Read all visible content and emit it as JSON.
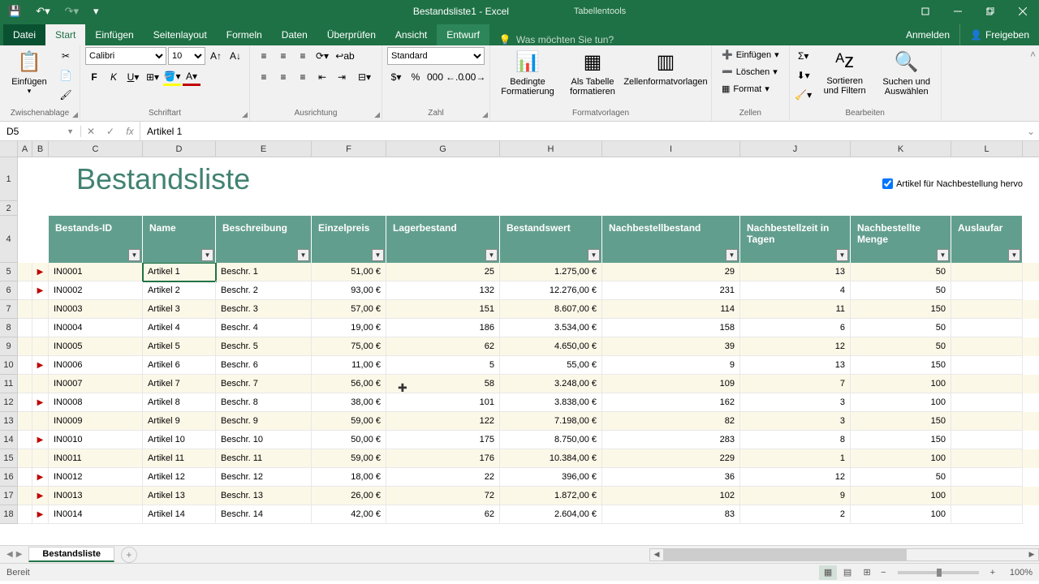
{
  "titlebar": {
    "app_title": "Bestandsliste1 - Excel",
    "table_tools": "Tabellentools"
  },
  "ribbon_tabs": {
    "datei": "Datei",
    "start": "Start",
    "einfuegen": "Einfügen",
    "seitenlayout": "Seitenlayout",
    "formeln": "Formeln",
    "daten": "Daten",
    "ueberpruefen": "Überprüfen",
    "ansicht": "Ansicht",
    "entwurf": "Entwurf",
    "tell_me": "Was möchten Sie tun?",
    "anmelden": "Anmelden",
    "freigeben": "Freigeben"
  },
  "ribbon": {
    "clipboard": {
      "label": "Zwischenablage",
      "paste": "Einfügen"
    },
    "font": {
      "label": "Schriftart",
      "name": "Calibri",
      "size": "10"
    },
    "alignment": {
      "label": "Ausrichtung"
    },
    "number": {
      "label": "Zahl",
      "format": "Standard"
    },
    "styles": {
      "label": "Formatvorlagen",
      "cond": "Bedingte Formatierung",
      "table": "Als Tabelle formatieren",
      "cell": "Zellenformatvorlagen"
    },
    "cells": {
      "label": "Zellen",
      "insert": "Einfügen",
      "delete": "Löschen",
      "format": "Format"
    },
    "editing": {
      "label": "Bearbeiten",
      "sort": "Sortieren und Filtern",
      "find": "Suchen und Auswählen"
    }
  },
  "formula_bar": {
    "name_box": "D5",
    "formula": "Artikel 1"
  },
  "columns": [
    "A",
    "B",
    "C",
    "D",
    "E",
    "F",
    "G",
    "H",
    "I",
    "J",
    "K",
    "L"
  ],
  "col_widths": [
    "cw-A",
    "cw-B",
    "cw-C",
    "cw-D",
    "cw-E",
    "cw-F",
    "cw-G",
    "cw-H",
    "cw-I",
    "cw-J",
    "cw-K",
    "cw-L"
  ],
  "sheet": {
    "title": "Bestandsliste",
    "checkbox_label": "Artikel für Nachbestellung hervo",
    "headers": [
      "Bestands-ID",
      "Name",
      "Beschreibung",
      "Einzelpreis",
      "Lagerbestand",
      "Bestandswert",
      "Nachbestellbestand",
      "Nachbestellzeit in Tagen",
      "Nachbestellte Menge",
      "Auslaufar"
    ],
    "rows": [
      {
        "flag": true,
        "id": "IN0001",
        "name": "Artikel 1",
        "desc": "Beschr. 1",
        "price": "51,00 €",
        "stock": "25",
        "value": "1.275,00 €",
        "reorder": "29",
        "days": "13",
        "qty": "50"
      },
      {
        "flag": true,
        "id": "IN0002",
        "name": "Artikel 2",
        "desc": "Beschr. 2",
        "price": "93,00 €",
        "stock": "132",
        "value": "12.276,00 €",
        "reorder": "231",
        "days": "4",
        "qty": "50"
      },
      {
        "flag": false,
        "id": "IN0003",
        "name": "Artikel 3",
        "desc": "Beschr. 3",
        "price": "57,00 €",
        "stock": "151",
        "value": "8.607,00 €",
        "reorder": "114",
        "days": "11",
        "qty": "150"
      },
      {
        "flag": false,
        "id": "IN0004",
        "name": "Artikel 4",
        "desc": "Beschr. 4",
        "price": "19,00 €",
        "stock": "186",
        "value": "3.534,00 €",
        "reorder": "158",
        "days": "6",
        "qty": "50"
      },
      {
        "flag": false,
        "id": "IN0005",
        "name": "Artikel 5",
        "desc": "Beschr. 5",
        "price": "75,00 €",
        "stock": "62",
        "value": "4.650,00 €",
        "reorder": "39",
        "days": "12",
        "qty": "50"
      },
      {
        "flag": true,
        "id": "IN0006",
        "name": "Artikel 6",
        "desc": "Beschr. 6",
        "price": "11,00 €",
        "stock": "5",
        "value": "55,00 €",
        "reorder": "9",
        "days": "13",
        "qty": "150"
      },
      {
        "flag": false,
        "id": "IN0007",
        "name": "Artikel 7",
        "desc": "Beschr. 7",
        "price": "56,00 €",
        "stock": "58",
        "value": "3.248,00 €",
        "reorder": "109",
        "days": "7",
        "qty": "100"
      },
      {
        "flag": true,
        "id": "IN0008",
        "name": "Artikel 8",
        "desc": "Beschr. 8",
        "price": "38,00 €",
        "stock": "101",
        "value": "3.838,00 €",
        "reorder": "162",
        "days": "3",
        "qty": "100"
      },
      {
        "flag": false,
        "id": "IN0009",
        "name": "Artikel 9",
        "desc": "Beschr. 9",
        "price": "59,00 €",
        "stock": "122",
        "value": "7.198,00 €",
        "reorder": "82",
        "days": "3",
        "qty": "150"
      },
      {
        "flag": true,
        "id": "IN0010",
        "name": "Artikel 10",
        "desc": "Beschr. 10",
        "price": "50,00 €",
        "stock": "175",
        "value": "8.750,00 €",
        "reorder": "283",
        "days": "8",
        "qty": "150"
      },
      {
        "flag": false,
        "id": "IN0011",
        "name": "Artikel 11",
        "desc": "Beschr. 11",
        "price": "59,00 €",
        "stock": "176",
        "value": "10.384,00 €",
        "reorder": "229",
        "days": "1",
        "qty": "100"
      },
      {
        "flag": true,
        "id": "IN0012",
        "name": "Artikel 12",
        "desc": "Beschr. 12",
        "price": "18,00 €",
        "stock": "22",
        "value": "396,00 €",
        "reorder": "36",
        "days": "12",
        "qty": "50"
      },
      {
        "flag": true,
        "id": "IN0013",
        "name": "Artikel 13",
        "desc": "Beschr. 13",
        "price": "26,00 €",
        "stock": "72",
        "value": "1.872,00 €",
        "reorder": "102",
        "days": "9",
        "qty": "100"
      },
      {
        "flag": true,
        "id": "IN0014",
        "name": "Artikel 14",
        "desc": "Beschr. 14",
        "price": "42,00 €",
        "stock": "62",
        "value": "2.604,00 €",
        "reorder": "83",
        "days": "2",
        "qty": "100"
      }
    ]
  },
  "sheet_tab": "Bestandsliste",
  "statusbar": {
    "ready": "Bereit",
    "zoom": "100%"
  }
}
